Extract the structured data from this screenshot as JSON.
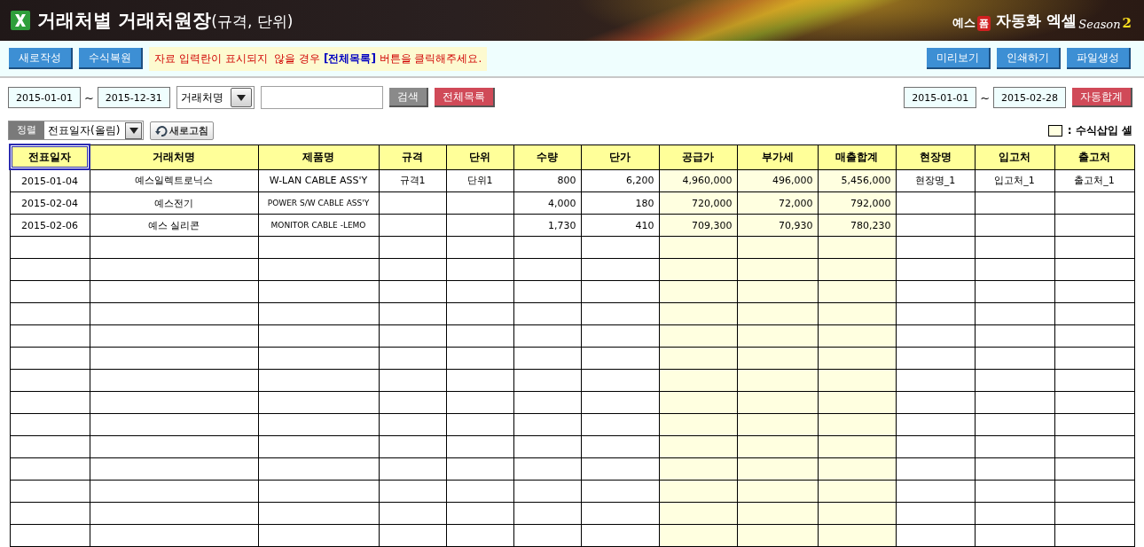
{
  "header": {
    "title": "거래처별 거래처원장",
    "subtitle": "(규격, 단위)",
    "brand": {
      "prefix": "예스",
      "badge": "폼",
      "name": "자동화 엑셀",
      "season": "Season",
      "number": "2"
    }
  },
  "toolbar": {
    "left_buttons": [
      "새로작성",
      "수식복원"
    ],
    "notice": "자료 입력란이 표시되지  않을 경우 **[전체목록]** 버튼을 클릭해주세요.",
    "right_buttons": [
      "미리보기",
      "인쇄하기",
      "파일생성"
    ]
  },
  "filter": {
    "date_from": "2015-01-01",
    "tilde": "~",
    "date_to": "2015-12-31",
    "field_select": "거래처명",
    "search_button": "검색",
    "all_button": "전체목록",
    "sum_from": "2015-01-01",
    "sum_tilde": "~",
    "sum_to": "2015-02-28",
    "sum_button": "자동합계"
  },
  "sort": {
    "label": "정렬",
    "value": "전표일자(올림)",
    "refresh": "새로고침"
  },
  "legend": {
    "text": ": 수식삽입 셀"
  },
  "table": {
    "columns": [
      {
        "label": "전표일자",
        "kind": "text",
        "formula": false,
        "selected": true
      },
      {
        "label": "거래처명",
        "kind": "text",
        "formula": false,
        "selected": false
      },
      {
        "label": "제품명",
        "kind": "text",
        "formula": false,
        "selected": false
      },
      {
        "label": "규격",
        "kind": "text",
        "formula": false,
        "selected": false
      },
      {
        "label": "단위",
        "kind": "text",
        "formula": false,
        "selected": false
      },
      {
        "label": "수량",
        "kind": "number",
        "formula": false,
        "selected": false
      },
      {
        "label": "단가",
        "kind": "number",
        "formula": false,
        "selected": false
      },
      {
        "label": "공급가",
        "kind": "number",
        "formula": true,
        "selected": false
      },
      {
        "label": "부가세",
        "kind": "number",
        "formula": true,
        "selected": false
      },
      {
        "label": "매출합계",
        "kind": "number",
        "formula": true,
        "selected": false
      },
      {
        "label": "현장명",
        "kind": "text",
        "formula": false,
        "selected": false
      },
      {
        "label": "입고처",
        "kind": "text",
        "formula": false,
        "selected": false
      },
      {
        "label": "출고처",
        "kind": "text",
        "formula": false,
        "selected": false
      }
    ],
    "rows": [
      [
        "2015-01-04",
        "예스일렉트로닉스",
        "W-LAN CABLE ASS'Y",
        "규격1",
        "단위1",
        "800",
        "6,200",
        "4,960,000",
        "496,000",
        "5,456,000",
        "현장명_1",
        "입고처_1",
        "출고처_1"
      ],
      [
        "2015-02-04",
        "예스전기",
        "POWER S/W CABLE ASS'Y",
        "",
        "",
        "4,000",
        "180",
        "720,000",
        "72,000",
        "792,000",
        "",
        "",
        ""
      ],
      [
        "2015-02-06",
        "예스 실리콘",
        "MONITOR CABLE -LEMO",
        "",
        "",
        "1,730",
        "410",
        "709,300",
        "70,930",
        "780,230",
        "",
        "",
        ""
      ]
    ]
  }
}
